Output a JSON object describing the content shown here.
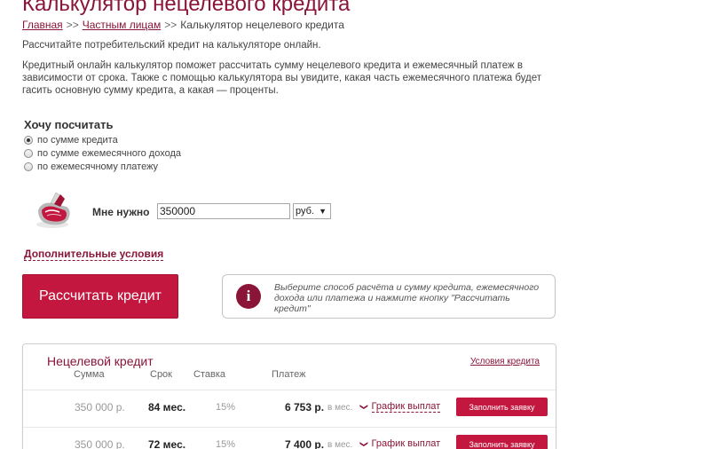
{
  "page": {
    "title": "Калькулятор нецелевого кредита",
    "breadcrumb": [
      {
        "label": "Главная"
      },
      {
        "label": "Частным лицам"
      },
      {
        "label": "Калькулятор нецелевого кредита"
      }
    ],
    "breadcrumb_sep": ">>",
    "intro": "Рассчитайте потребительский кредит на калькуляторе онлайн.",
    "description": "Кредитный онлайн калькулятор поможет рассчитать сумму нецелевого кредита и ежемесячный платеж в зависимости от срока. Также с помощью калькулятора вы увидите, какая часть ежемесячного платежа будет гасить основную сумму кредита, а какая — проценты."
  },
  "form": {
    "want_label": "Хочу посчитать",
    "options": [
      {
        "label": "по сумме кредита",
        "selected": true
      },
      {
        "label": "по сумме ежемесячного дохода",
        "selected": false
      },
      {
        "label": "по ежемесячному платежу",
        "selected": false
      }
    ],
    "need_label": "Мне нужно",
    "amount": "350000",
    "currency": "руб.",
    "extra_conditions": "Дополнительные условия",
    "calc_button": "Рассчитать кредит",
    "info_text": "Выберите способ расчёта и сумму кредита, ежемесячного дохода или платежа и нажмите кнопку \"Рассчитать кредит\""
  },
  "results": {
    "title": "Нецелевой кредит",
    "conditions_link": "Условия кредита",
    "headers": {
      "sum": "Сумма",
      "term": "Срок",
      "rate": "Ставка",
      "payment": "Платеж"
    },
    "rows": [
      {
        "sum": "350 000 р.",
        "term": "84 мес.",
        "rate": "15%",
        "payment": "6 753 р.",
        "per": "в мес.",
        "schedule": "График выплат",
        "apply": "Заполнить заявку"
      },
      {
        "sum": "350 000 р.",
        "term": "72 мес.",
        "rate": "15%",
        "payment": "7 400 р.",
        "per": "в мес.",
        "schedule": "График выплат",
        "apply": "Заполнить заявку"
      }
    ]
  },
  "colors": {
    "accent": "#8a1538",
    "button": "#c4173f"
  },
  "icons": {
    "wallet": "wallet-icon",
    "info": "info-icon",
    "chevron": "chevron-down-icon"
  }
}
